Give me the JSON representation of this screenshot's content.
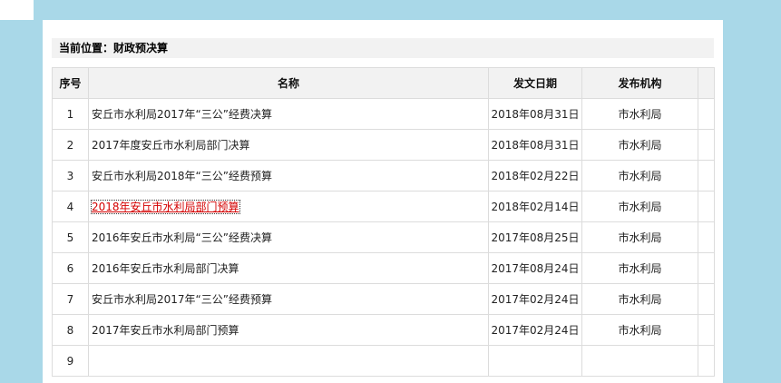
{
  "breadcrumb": {
    "text": "当前位置：财政预决算"
  },
  "table": {
    "headers": {
      "index": "序号",
      "name": "名称",
      "date": "发文日期",
      "org": "发布机构"
    },
    "rows": [
      {
        "index": "1",
        "name": "安丘市水利局2017年“三公”经费决算",
        "date": "2018年08月31日",
        "org": "市水利局"
      },
      {
        "index": "2",
        "name": "2017年度安丘市水利局部门决算",
        "date": "2018年08月31日",
        "org": "市水利局"
      },
      {
        "index": "3",
        "name": "安丘市水利局2018年“三公”经费预算",
        "date": "2018年02月22日",
        "org": "市水利局"
      },
      {
        "index": "4",
        "name": "2018年安丘市水利局部门预算",
        "date": "2018年02月14日",
        "org": "市水利局",
        "active": true
      },
      {
        "index": "5",
        "name": "2016年安丘市水利局“三公”经费决算",
        "date": "2017年08月25日",
        "org": "市水利局"
      },
      {
        "index": "6",
        "name": "2016年安丘市水利局部门决算",
        "date": "2017年08月24日",
        "org": "市水利局"
      },
      {
        "index": "7",
        "name": "安丘市水利局2017年“三公”经费预算",
        "date": "2017年02月24日",
        "org": "市水利局"
      },
      {
        "index": "8",
        "name": "2017年安丘市水利局部门预算",
        "date": "2017年02月24日",
        "org": "市水利局"
      },
      {
        "index": "9",
        "name": "",
        "date": "",
        "org": ""
      }
    ]
  },
  "colors": {
    "background": "#a9d8e8",
    "link_active": "#d40000"
  }
}
